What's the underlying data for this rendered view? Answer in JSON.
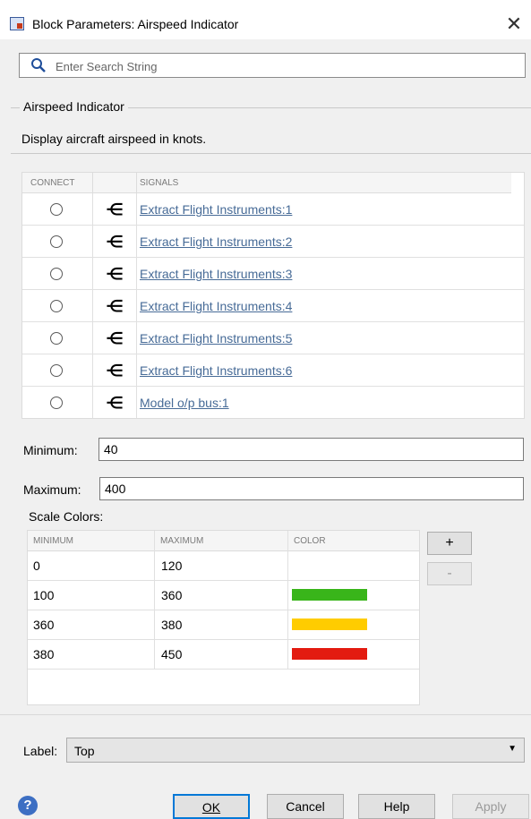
{
  "window": {
    "title": "Block Parameters: Airspeed Indicator",
    "close_icon": "close-icon",
    "app_icon": "simulink-block-icon"
  },
  "search": {
    "placeholder": "Enter Search String",
    "icon": "search-icon"
  },
  "group": {
    "title": "Airspeed Indicator",
    "description": "Display aircraft airspeed in knots."
  },
  "signals_table": {
    "headers": {
      "connect": "CONNECT",
      "port": "",
      "signals": "SIGNALS"
    },
    "rows": [
      {
        "connected": false,
        "signal": "Extract Flight Instruments:1"
      },
      {
        "connected": false,
        "signal": "Extract Flight Instruments:2"
      },
      {
        "connected": false,
        "signal": "Extract Flight Instruments:3"
      },
      {
        "connected": false,
        "signal": "Extract Flight Instruments:4"
      },
      {
        "connected": false,
        "signal": "Extract Flight Instruments:5"
      },
      {
        "connected": false,
        "signal": "Extract Flight Instruments:6"
      },
      {
        "connected": false,
        "signal": "Model o/p bus:1"
      }
    ]
  },
  "fields": {
    "minimum_label": "Minimum:",
    "minimum_value": "40",
    "maximum_label": "Maximum:",
    "maximum_value": "400"
  },
  "scale_colors": {
    "label": "Scale Colors:",
    "headers": {
      "minimum": "MINIMUM",
      "maximum": "MAXIMUM",
      "color": "COLOR"
    },
    "rows": [
      {
        "minimum": "0",
        "maximum": "120",
        "color": ""
      },
      {
        "minimum": "100",
        "maximum": "360",
        "color": "#39b51a"
      },
      {
        "minimum": "360",
        "maximum": "380",
        "color": "#ffcc00"
      },
      {
        "minimum": "380",
        "maximum": "450",
        "color": "#e31b10"
      }
    ],
    "add_label": "+",
    "remove_label": "-"
  },
  "label_select": {
    "label": "Label:",
    "value": "Top"
  },
  "footer": {
    "help_icon": "help-icon",
    "ok": "OK",
    "cancel": "Cancel",
    "help": "Help",
    "apply": "Apply"
  }
}
